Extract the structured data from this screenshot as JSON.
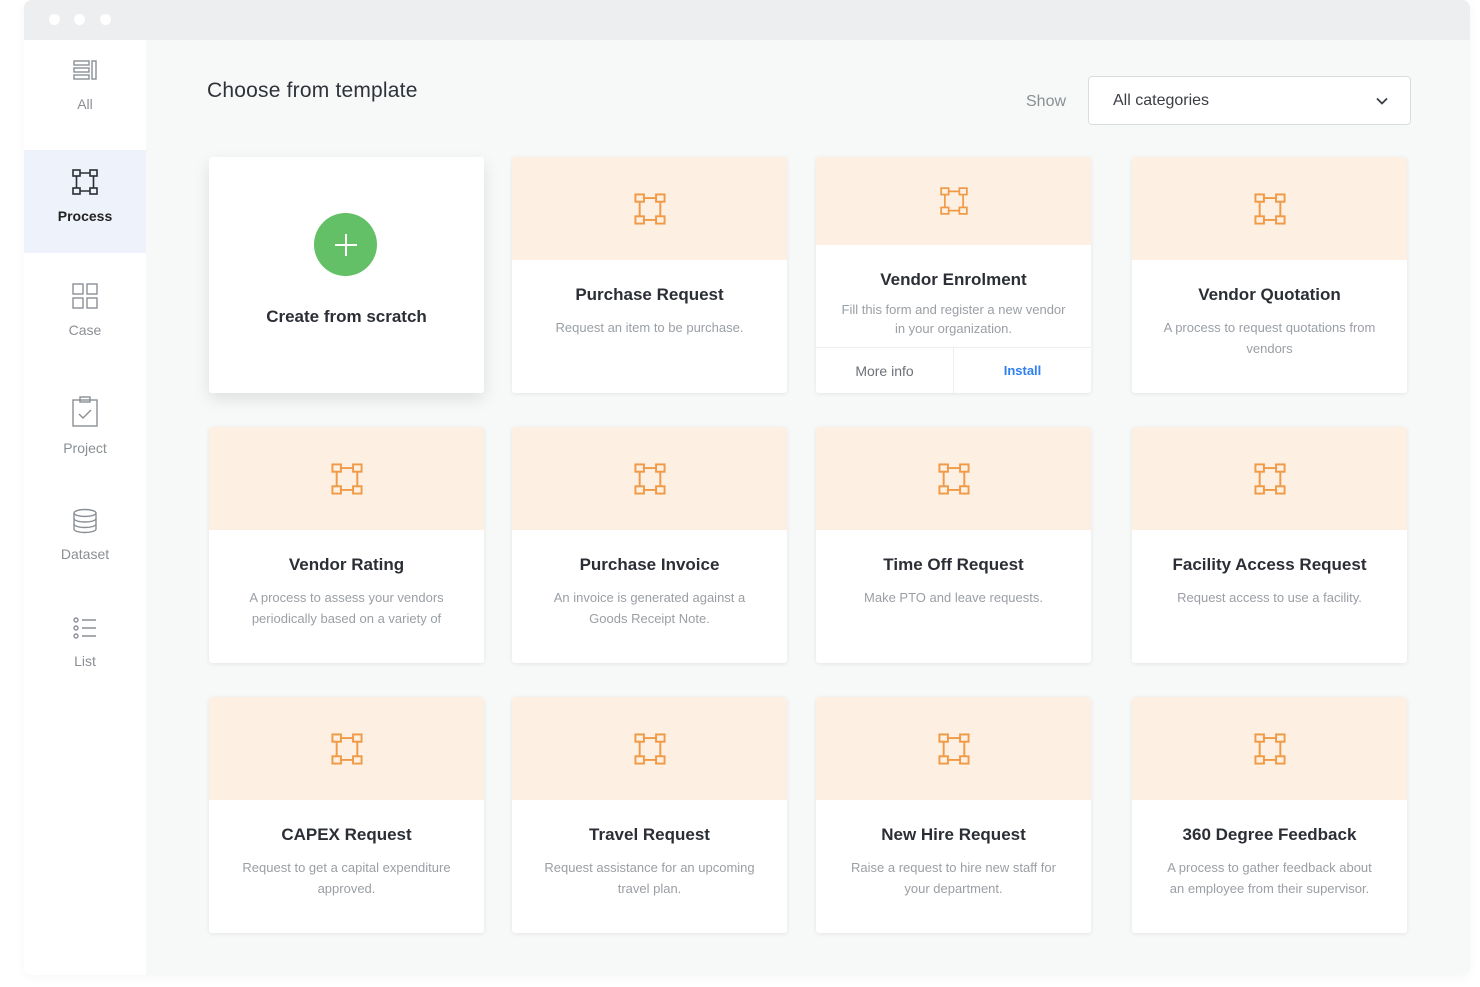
{
  "sidebar": {
    "items": [
      {
        "label": "All",
        "icon": "list-columns-icon"
      },
      {
        "label": "Process",
        "icon": "process-flow-icon",
        "active": true
      },
      {
        "label": "Case",
        "icon": "grid-icon"
      },
      {
        "label": "Project",
        "icon": "clipboard-check-icon"
      },
      {
        "label": "Dataset",
        "icon": "database-icon"
      },
      {
        "label": "List",
        "icon": "bullet-list-icon"
      }
    ]
  },
  "header": {
    "title": "Choose from template",
    "show_label": "Show",
    "category_select": "All categories"
  },
  "scratch": {
    "label": "Create from scratch"
  },
  "templates": [
    {
      "title": "Purchase Request",
      "desc": "Request an item to be purchase."
    },
    {
      "title": "Vendor Enrolment",
      "desc": "Fill this form and register a new vendor in your organization.",
      "more_info": "More info",
      "install": "Install"
    },
    {
      "title": "Vendor Quotation",
      "desc": "A process to request quotations from vendors"
    },
    {
      "title": "Vendor Rating",
      "desc": "A process to assess your vendors periodically based on a variety of"
    },
    {
      "title": "Purchase Invoice",
      "desc": "An invoice is generated against a Goods Receipt Note."
    },
    {
      "title": "Time Off Request",
      "desc": "Make PTO and leave requests."
    },
    {
      "title": "Facility Access Request",
      "desc": "Request access to use a facility."
    },
    {
      "title": "CAPEX Request",
      "desc": "Request to get a capital expenditure approved."
    },
    {
      "title": "Travel Request",
      "desc": "Request assistance for an upcoming travel plan."
    },
    {
      "title": "New Hire Request",
      "desc": "Raise a request to hire new staff for your department."
    },
    {
      "title": "360 Degree Feedback",
      "desc": "A process to gather feedback about an employee from their supervisor."
    }
  ],
  "colors": {
    "accent_orange": "#f09a46",
    "card_header": "#fdf0e2",
    "plus_green": "#63c067",
    "link_blue": "#2f7ff0"
  }
}
